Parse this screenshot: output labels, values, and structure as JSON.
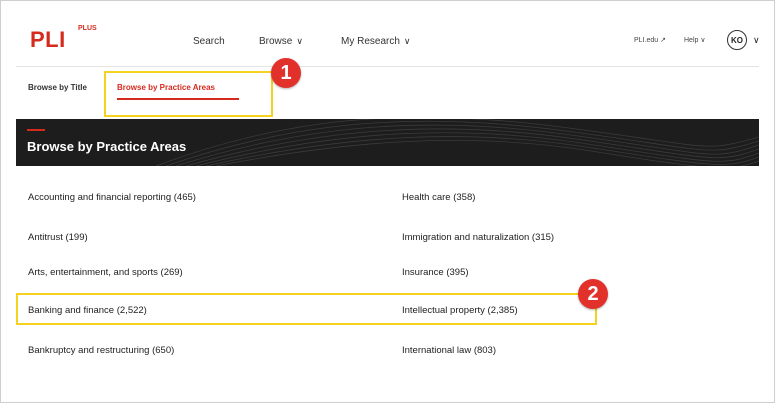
{
  "header": {
    "logo": "PLI",
    "logo_sup": "PLUS",
    "nav": [
      {
        "label": "Search",
        "chevron": false
      },
      {
        "label": "Browse",
        "chevron": true
      },
      {
        "label": "My Research",
        "chevron": true
      }
    ],
    "utility": [
      {
        "label": "PLI.edu",
        "icon": "external-link-icon"
      },
      {
        "label": "Help",
        "icon": "chevron-down-icon"
      }
    ],
    "avatar_initials": "KO"
  },
  "tabs": [
    {
      "label": "Browse by Title",
      "active": false
    },
    {
      "label": "Browse by Practice Areas",
      "active": true
    }
  ],
  "banner": {
    "title": "Browse by Practice Areas"
  },
  "practice_areas": {
    "left": [
      "Accounting and financial reporting (465)",
      "Antitrust (199)",
      "Arts, entertainment, and sports (269)",
      "Banking and finance (2,522)",
      "Bankruptcy and restructuring (650)"
    ],
    "right": [
      "Health care (358)",
      "Immigration and naturalization (315)",
      "Insurance (395)",
      "Intellectual property (2,385)",
      "International law (803)"
    ]
  },
  "callouts": [
    "1",
    "2"
  ],
  "colors": {
    "brand": "#d52b1e",
    "highlight": "#f4d21f",
    "badge": "#e2302b",
    "banner": "#1d1d1d"
  }
}
